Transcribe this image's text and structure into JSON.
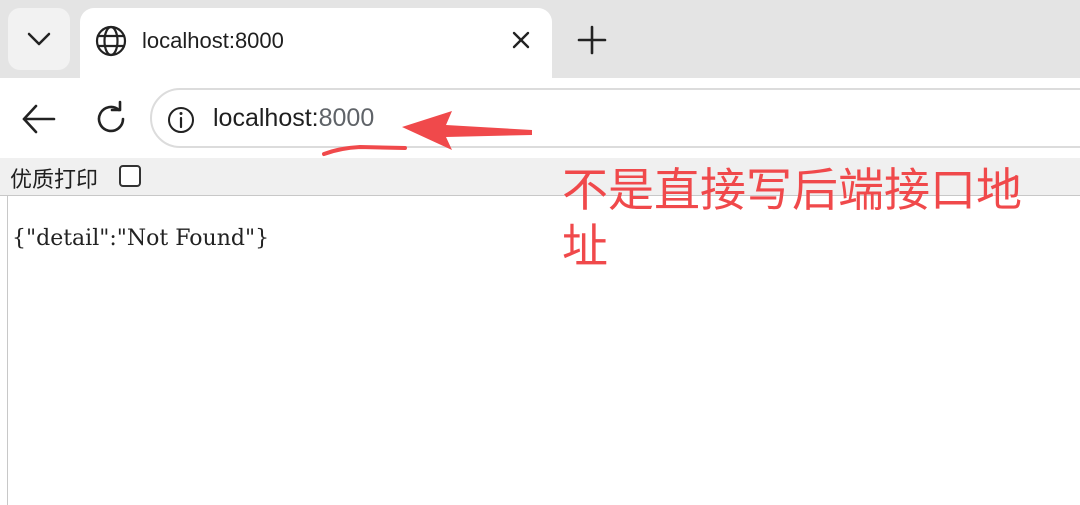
{
  "browser": {
    "tab": {
      "title": "localhost:8000",
      "icon": "globe-icon"
    },
    "address_bar": {
      "host": "localhost:",
      "port": "8000"
    },
    "icons": {
      "tab_menu": "chevron-down-icon",
      "close": "close-icon",
      "new_tab": "plus-icon",
      "back": "back-arrow-icon",
      "reload": "reload-icon",
      "site_info": "info-icon"
    }
  },
  "page": {
    "quality_print_label": "优质打印",
    "quality_print_checked": false,
    "response_body": "{\"detail\":\"Not Found\"}"
  },
  "annotation": {
    "text": "不是直接写后端接口地址",
    "color": "#f0494b"
  }
}
